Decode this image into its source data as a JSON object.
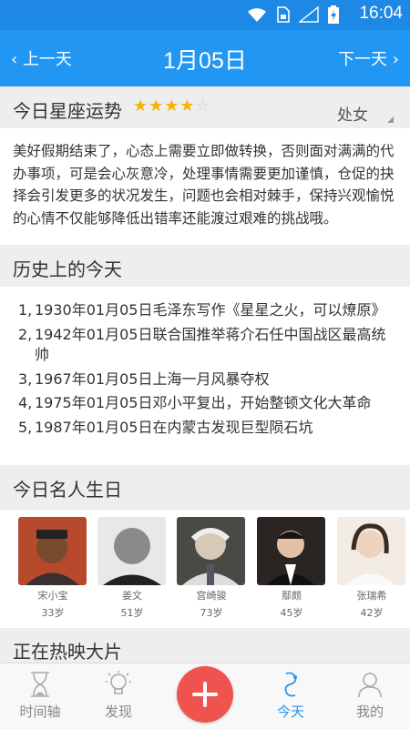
{
  "status_bar": {
    "time": "16:04",
    "icons": [
      "wifi-icon",
      "sim-icon",
      "signal-icon",
      "battery-charging-icon"
    ]
  },
  "header": {
    "prev_label": "上一天",
    "date": "1月05日",
    "next_label": "下一天"
  },
  "horoscope": {
    "title": "今日星座运势",
    "rating": 4,
    "rating_max": 5,
    "sign": "处女",
    "text": "美好假期结束了，心态上需要立即做转换，否则面对满满的代办事项，可是会心灰意冷，处理事情需要更加谨慎，仓促的抉择会引发更多的状况发生，问题也会相对棘手，保持兴观愉悦的心情不仅能够降低出错率还能渡过艰难的挑战哦。"
  },
  "history": {
    "title": "历史上的今天",
    "items": [
      {
        "num": "1,",
        "text": "1930年01月05日毛泽东写作《星星之火，可以燎原》"
      },
      {
        "num": "2,",
        "text": "1942年01月05日联合国推举蒋介石任中国战区最高统帅"
      },
      {
        "num": "3,",
        "text": "1967年01月05日上海一月风暴夺权"
      },
      {
        "num": "4,",
        "text": "1975年01月05日邓小平复出，开始整顿文化大革命"
      },
      {
        "num": "5,",
        "text": "1987年01月05日在内蒙古发现巨型陨石坑"
      }
    ]
  },
  "birthdays": {
    "title": "今日名人生日",
    "people": [
      {
        "name": "宋小宝",
        "age": "33岁"
      },
      {
        "name": "姜文",
        "age": "51岁"
      },
      {
        "name": "宫崎骏",
        "age": "73岁"
      },
      {
        "name": "鄢颇",
        "age": "45岁"
      },
      {
        "name": "张瑞希",
        "age": "42岁"
      }
    ]
  },
  "movies": {
    "title": "正在热映大片"
  },
  "tabbar": {
    "tabs": [
      {
        "label": "时间轴",
        "icon": "hourglass-icon"
      },
      {
        "label": "发现",
        "icon": "lightbulb-icon"
      },
      {
        "label": "今天",
        "icon": "today-icon"
      },
      {
        "label": "我的",
        "icon": "user-icon"
      }
    ],
    "active": "今天",
    "fab_icon": "plus-icon"
  },
  "colors": {
    "primary": "#2196f3",
    "status_bar": "#1e88e5",
    "fab": "#ef5350",
    "star": "#f5b400"
  }
}
